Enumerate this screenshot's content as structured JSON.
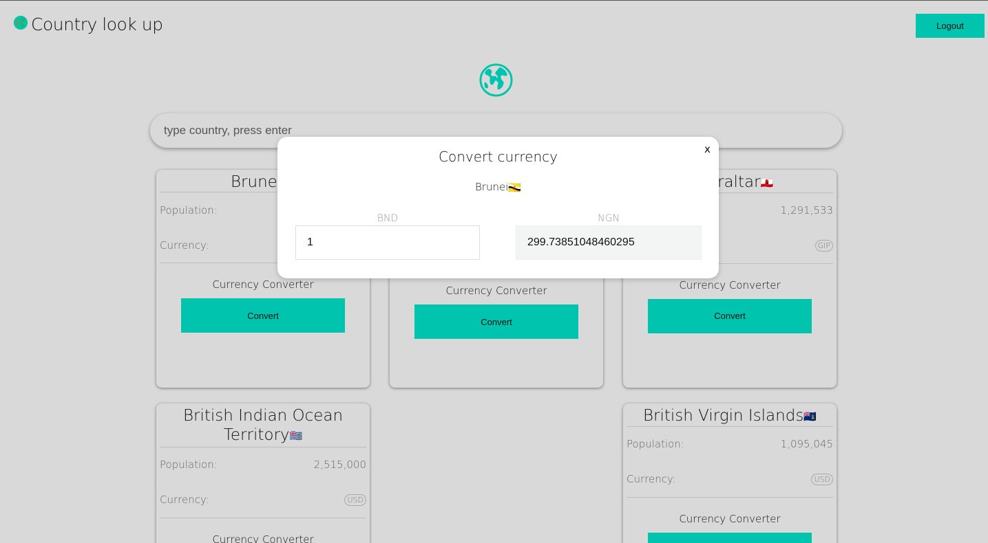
{
  "header": {
    "title": "Country look up",
    "logout_label": "Logout"
  },
  "search": {
    "placeholder": "type country, press enter"
  },
  "cards": [
    {
      "name": "Brunei",
      "flag": "🇧🇳",
      "population_label": "Population:",
      "currency_label": "Currency:",
      "converter_label": "Currency Converter",
      "button_label": "Convert"
    },
    {
      "converter_label": "Currency Converter",
      "button_label": "Convert"
    },
    {
      "name": "raltar",
      "flag": "🇬🇮",
      "population": "1,291,533",
      "currency": "GIP",
      "converter_label": "Currency Converter",
      "button_label": "Convert"
    },
    {
      "name": "British Indian Ocean Territory",
      "flag": "🇮🇴",
      "population_label": "Population:",
      "population": "2,515,000",
      "currency_label": "Currency:",
      "currency": "USD",
      "converter_label": "Currency Converter"
    },
    {
      "name": "British Virgin Islands",
      "flag": "🇻🇬",
      "population_label": "Population:",
      "population": "1,095,045",
      "currency_label": "Currency:",
      "currency": "USD",
      "converter_label": "Currency Converter"
    }
  ],
  "modal": {
    "title": "Convert currency",
    "close_label": "x",
    "country": "Brunei",
    "flag": "🇧🇳",
    "from_currency": "BND",
    "to_currency": "NGN",
    "from_value": "1",
    "to_value": "299.73851048460295"
  },
  "colors": {
    "accent": "#00c4ad",
    "background": "#d9d9d9"
  }
}
